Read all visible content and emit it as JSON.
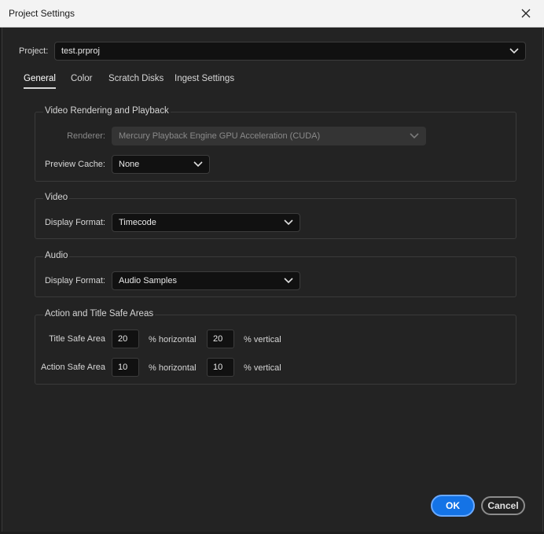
{
  "window": {
    "title": "Project Settings"
  },
  "project": {
    "label": "Project:",
    "value": "test.prproj"
  },
  "tabs": [
    {
      "label": "General",
      "active": true
    },
    {
      "label": "Color"
    },
    {
      "label": "Scratch Disks"
    },
    {
      "label": "Ingest Settings"
    }
  ],
  "video_rendering": {
    "title": "Video Rendering and Playback",
    "renderer_label": "Renderer:",
    "renderer_value": "Mercury Playback Engine GPU Acceleration (CUDA)",
    "preview_cache_label": "Preview Cache:",
    "preview_cache_value": "None"
  },
  "video": {
    "title": "Video",
    "display_format_label": "Display Format:",
    "display_format_value": "Timecode"
  },
  "audio": {
    "title": "Audio",
    "display_format_label": "Display Format:",
    "display_format_value": "Audio Samples"
  },
  "safe_areas": {
    "title": "Action and Title Safe Areas",
    "title_safe_label": "Title Safe Area",
    "title_horizontal": "20",
    "title_vertical": "20",
    "action_safe_label": "Action Safe Area",
    "action_horizontal": "10",
    "action_vertical": "10",
    "horizontal_unit": "% horizontal",
    "vertical_unit": "% vertical"
  },
  "buttons": {
    "ok": "OK",
    "cancel": "Cancel"
  },
  "colors": {
    "accent": "#1473e6",
    "background": "#232323",
    "field": "#111111"
  }
}
